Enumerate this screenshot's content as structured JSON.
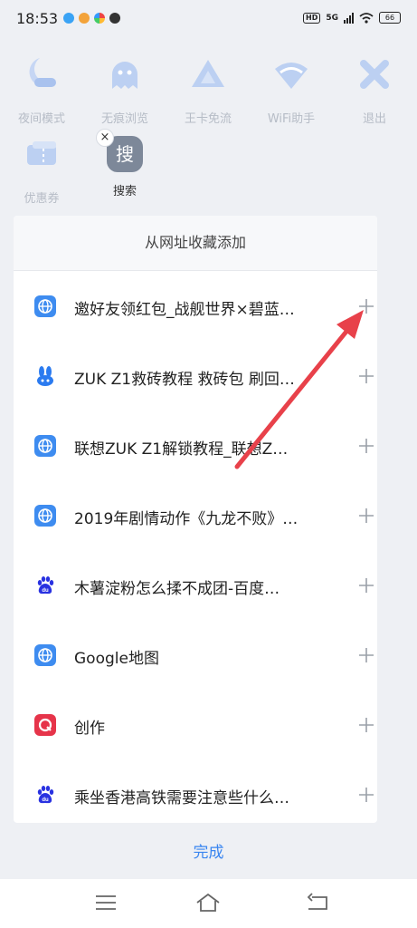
{
  "status": {
    "time": "18:53",
    "hd": "HD",
    "network": "5G",
    "battery": "66"
  },
  "quick_menu": [
    {
      "label": "夜间模式",
      "icon": "night-mode-icon"
    },
    {
      "label": "无痕浏览",
      "icon": "incognito-icon"
    },
    {
      "label": "王卡免流",
      "icon": "king-card-icon"
    },
    {
      "label": "WiFi助手",
      "icon": "wifi-icon"
    },
    {
      "label": "退出",
      "icon": "exit-icon"
    },
    {
      "label": "优惠券",
      "icon": "coupon-icon"
    },
    {
      "label": "搜索",
      "icon": "search-icon",
      "glyph": "搜"
    }
  ],
  "remove_glyph": "×",
  "panel": {
    "header": "从网址收藏添加",
    "items": [
      {
        "title": "邀好友领红包_战舰世界×碧蓝…",
        "favicon": "globe-icon"
      },
      {
        "title": "ZUK Z1救砖教程 救砖包 刷回…",
        "favicon": "zuk-rabbit-icon"
      },
      {
        "title": "联想ZUK Z1解锁教程_联想Z…",
        "favicon": "globe-icon"
      },
      {
        "title": "2019年剧情动作《九龙不败》…",
        "favicon": "globe-icon"
      },
      {
        "title": "木薯淀粉怎么揉不成团-百度…",
        "favicon": "baidu-icon"
      },
      {
        "title": "Google地图",
        "favicon": "globe-icon"
      },
      {
        "title": "创作",
        "favicon": "create-icon"
      },
      {
        "title": "乘坐香港高铁需要注意些什么…",
        "favicon": "baidu-icon"
      }
    ]
  },
  "done_label": "完成",
  "colors": {
    "accent": "#3a86f0",
    "annotation_arrow": "#e8414a"
  }
}
